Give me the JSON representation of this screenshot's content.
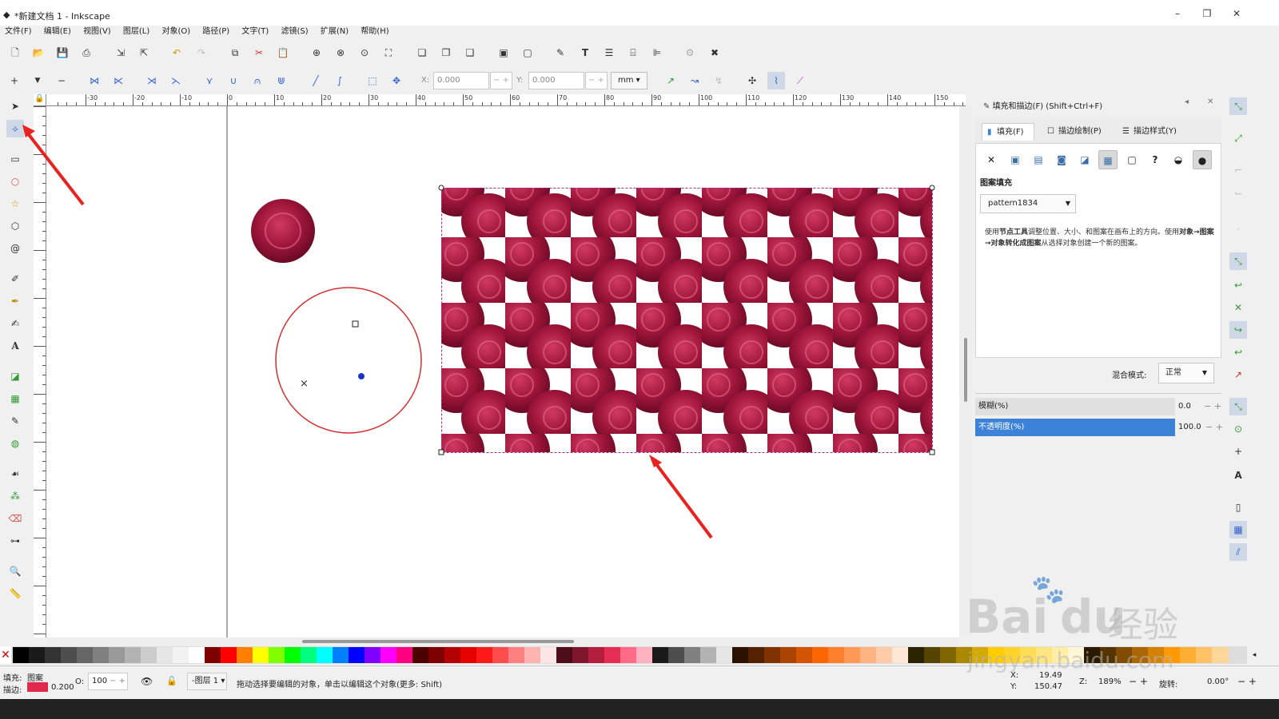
{
  "window": {
    "title": "*新建文档 1 - Inkscape",
    "minimize": "–",
    "maximize": "❐",
    "close": "✕"
  },
  "menu": [
    "文件(F)",
    "编辑(E)",
    "视图(V)",
    "图层(L)",
    "对象(O)",
    "路径(P)",
    "文字(T)",
    "滤镜(S)",
    "扩展(N)",
    "帮助(H)"
  ],
  "controls": {
    "x_label": "X:",
    "x_value": "0.000",
    "y_label": "Y:",
    "y_value": "0.000",
    "unit": "mm"
  },
  "ruler": {
    "labels": [
      "-30",
      "-20",
      "-10",
      "0",
      "10",
      "20",
      "30",
      "40",
      "50",
      "60",
      "70",
      "80",
      "90",
      "100",
      "110",
      "120",
      "130",
      "140",
      "150"
    ]
  },
  "dock": {
    "title": "填充和描边(F) (Shift+Ctrl+F)",
    "tabs": [
      "填充(F)",
      "描边绘制(P)",
      "描边样式(Y)"
    ],
    "section": "图案填充",
    "pattern": "pattern1834",
    "hint_parts": [
      "使用",
      "节点工具",
      "调整位置、大小、和图案在画布上的方向。使用",
      "对象→图案→对象转化成图案",
      "从选择对象创建一个新的图案。"
    ],
    "blend_label": "混合模式:",
    "blend_value": "正常",
    "blur_label": "模糊(%)",
    "blur_value": "0.0",
    "opacity_label": "不透明度(%)",
    "opacity_value": "100.0"
  },
  "status": {
    "fill_label": "填充:",
    "fill_value": "图案",
    "stroke_label": "描边:",
    "stroke_value": "0.200",
    "opacity_label": "O:",
    "opacity_value": "100",
    "layer": "-图层 1",
    "message": "拖动选择要编辑的对象，单击以编辑这个对象(更多: Shift)",
    "x_label": "X:",
    "x": "19.49",
    "y_label": "Y:",
    "y": "150.47",
    "zoom_label": "Z:",
    "zoom": "189%",
    "rotate_label": "旋转:",
    "rotate": "0.00°"
  },
  "watermark": {
    "line1": "Bai",
    "line2": "du",
    "line3": "经验",
    "url": "jingyan.baidu.com"
  },
  "colors": {
    "accent": "#3b82d8",
    "stroke_red": "#d32f2f",
    "flower": "#a0163a",
    "arrow": "#e8221f"
  }
}
